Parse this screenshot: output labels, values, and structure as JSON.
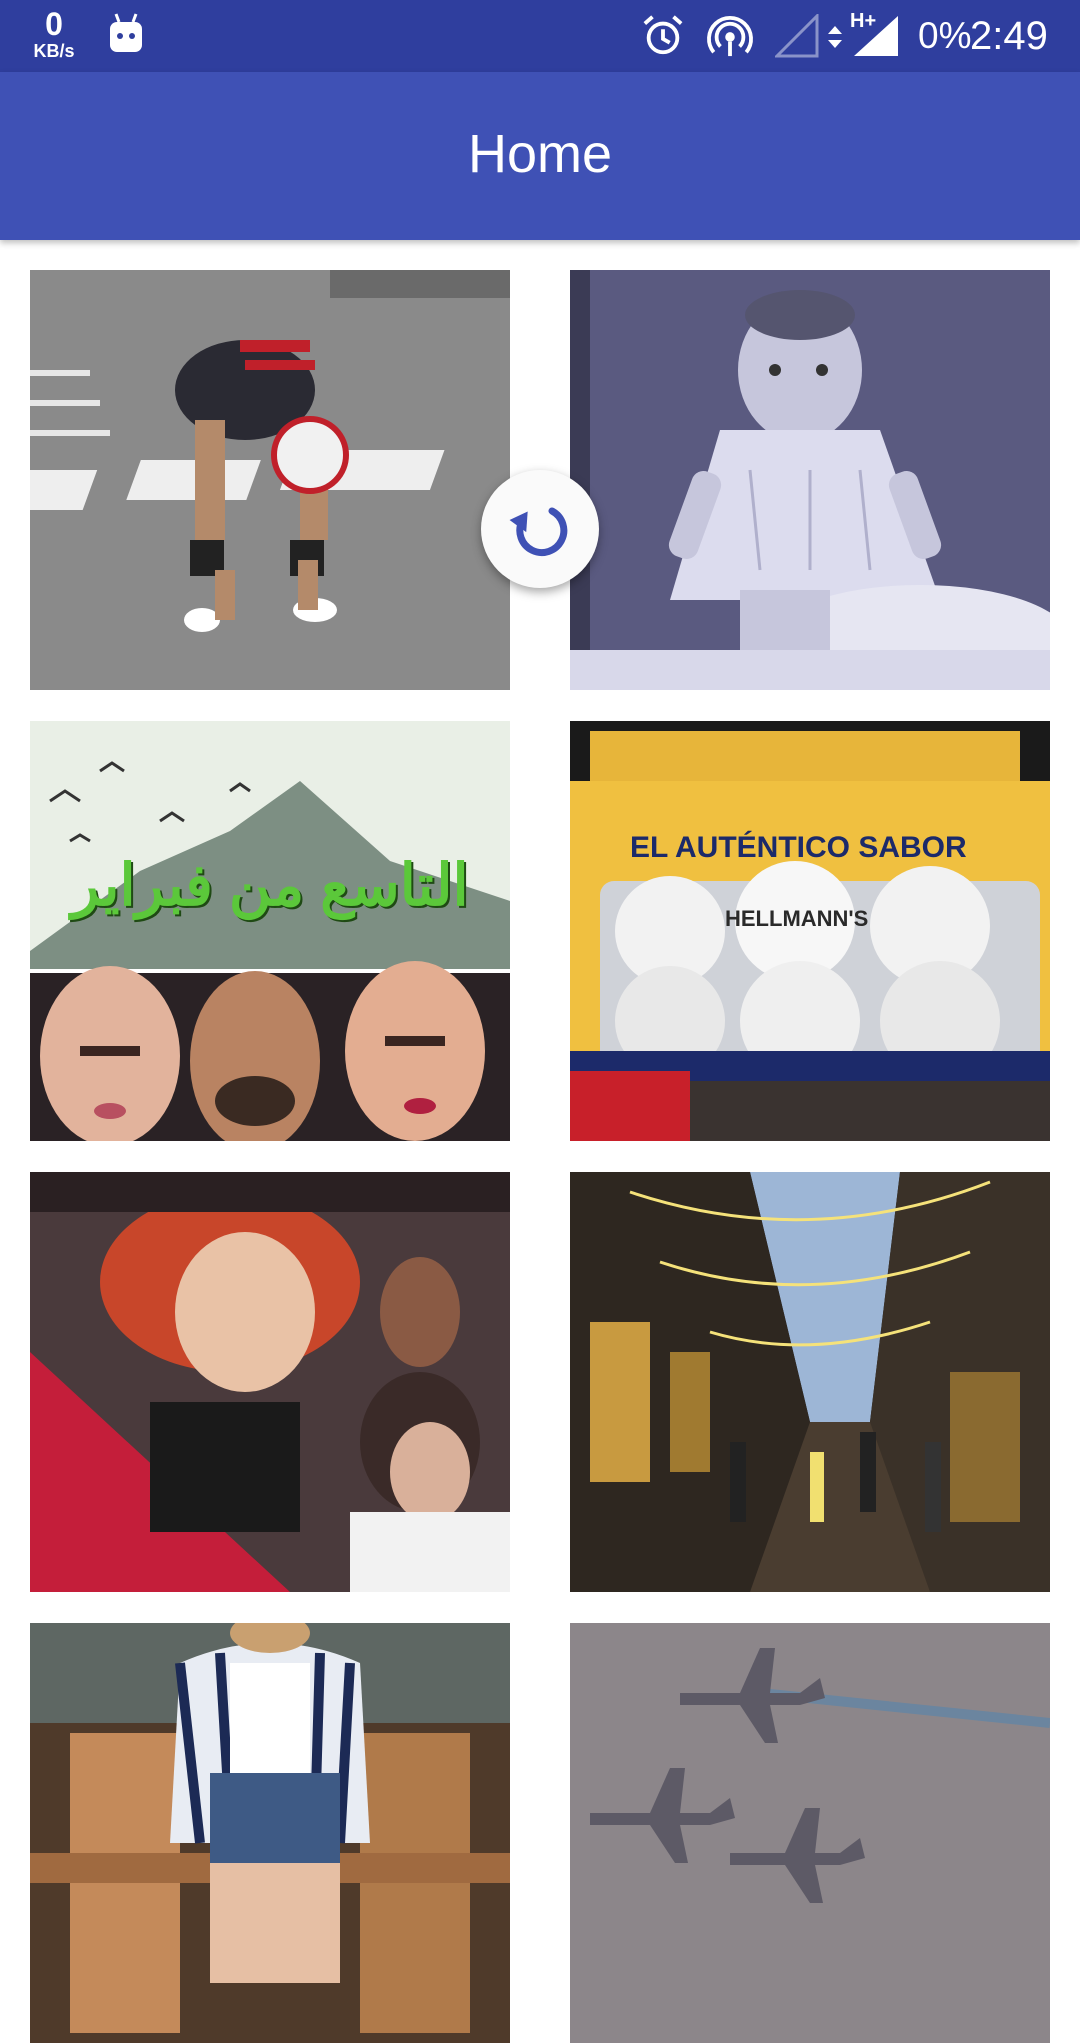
{
  "status_bar": {
    "net_speed_value": "0",
    "net_speed_unit": "KB/s",
    "network_type": "H+",
    "battery": "0%",
    "time": "2:49",
    "icons": [
      "android-icon",
      "alarm-icon",
      "hotspot-icon",
      "signal-empty-icon",
      "data-arrows-icon",
      "signal-full-icon"
    ]
  },
  "app_bar": {
    "title": "Home"
  },
  "grid": {
    "tiles": [
      {
        "subject": "cyclist bending over on crosswalk"
      },
      {
        "subject": "vintage photo of baby in dress"
      },
      {
        "subject": "poster with green arabic title and three faces",
        "text": "التاسع من فبراير"
      },
      {
        "subject": "box of Hellmann's mayonnaise",
        "text": "EL AUTÉNTICO SABOR",
        "brand": "HELLMANN'S"
      },
      {
        "subject": "red-haired woman in crowd"
      },
      {
        "subject": "narrow street with string lights at dusk"
      },
      {
        "subject": "woman in striped jacket sitting on bench"
      },
      {
        "subject": "jet aircraft formation in grey sky"
      }
    ]
  },
  "colors": {
    "status_bar": "#2f3e9e",
    "app_bar": "#3f51b5",
    "accent": "#3f51b5"
  }
}
